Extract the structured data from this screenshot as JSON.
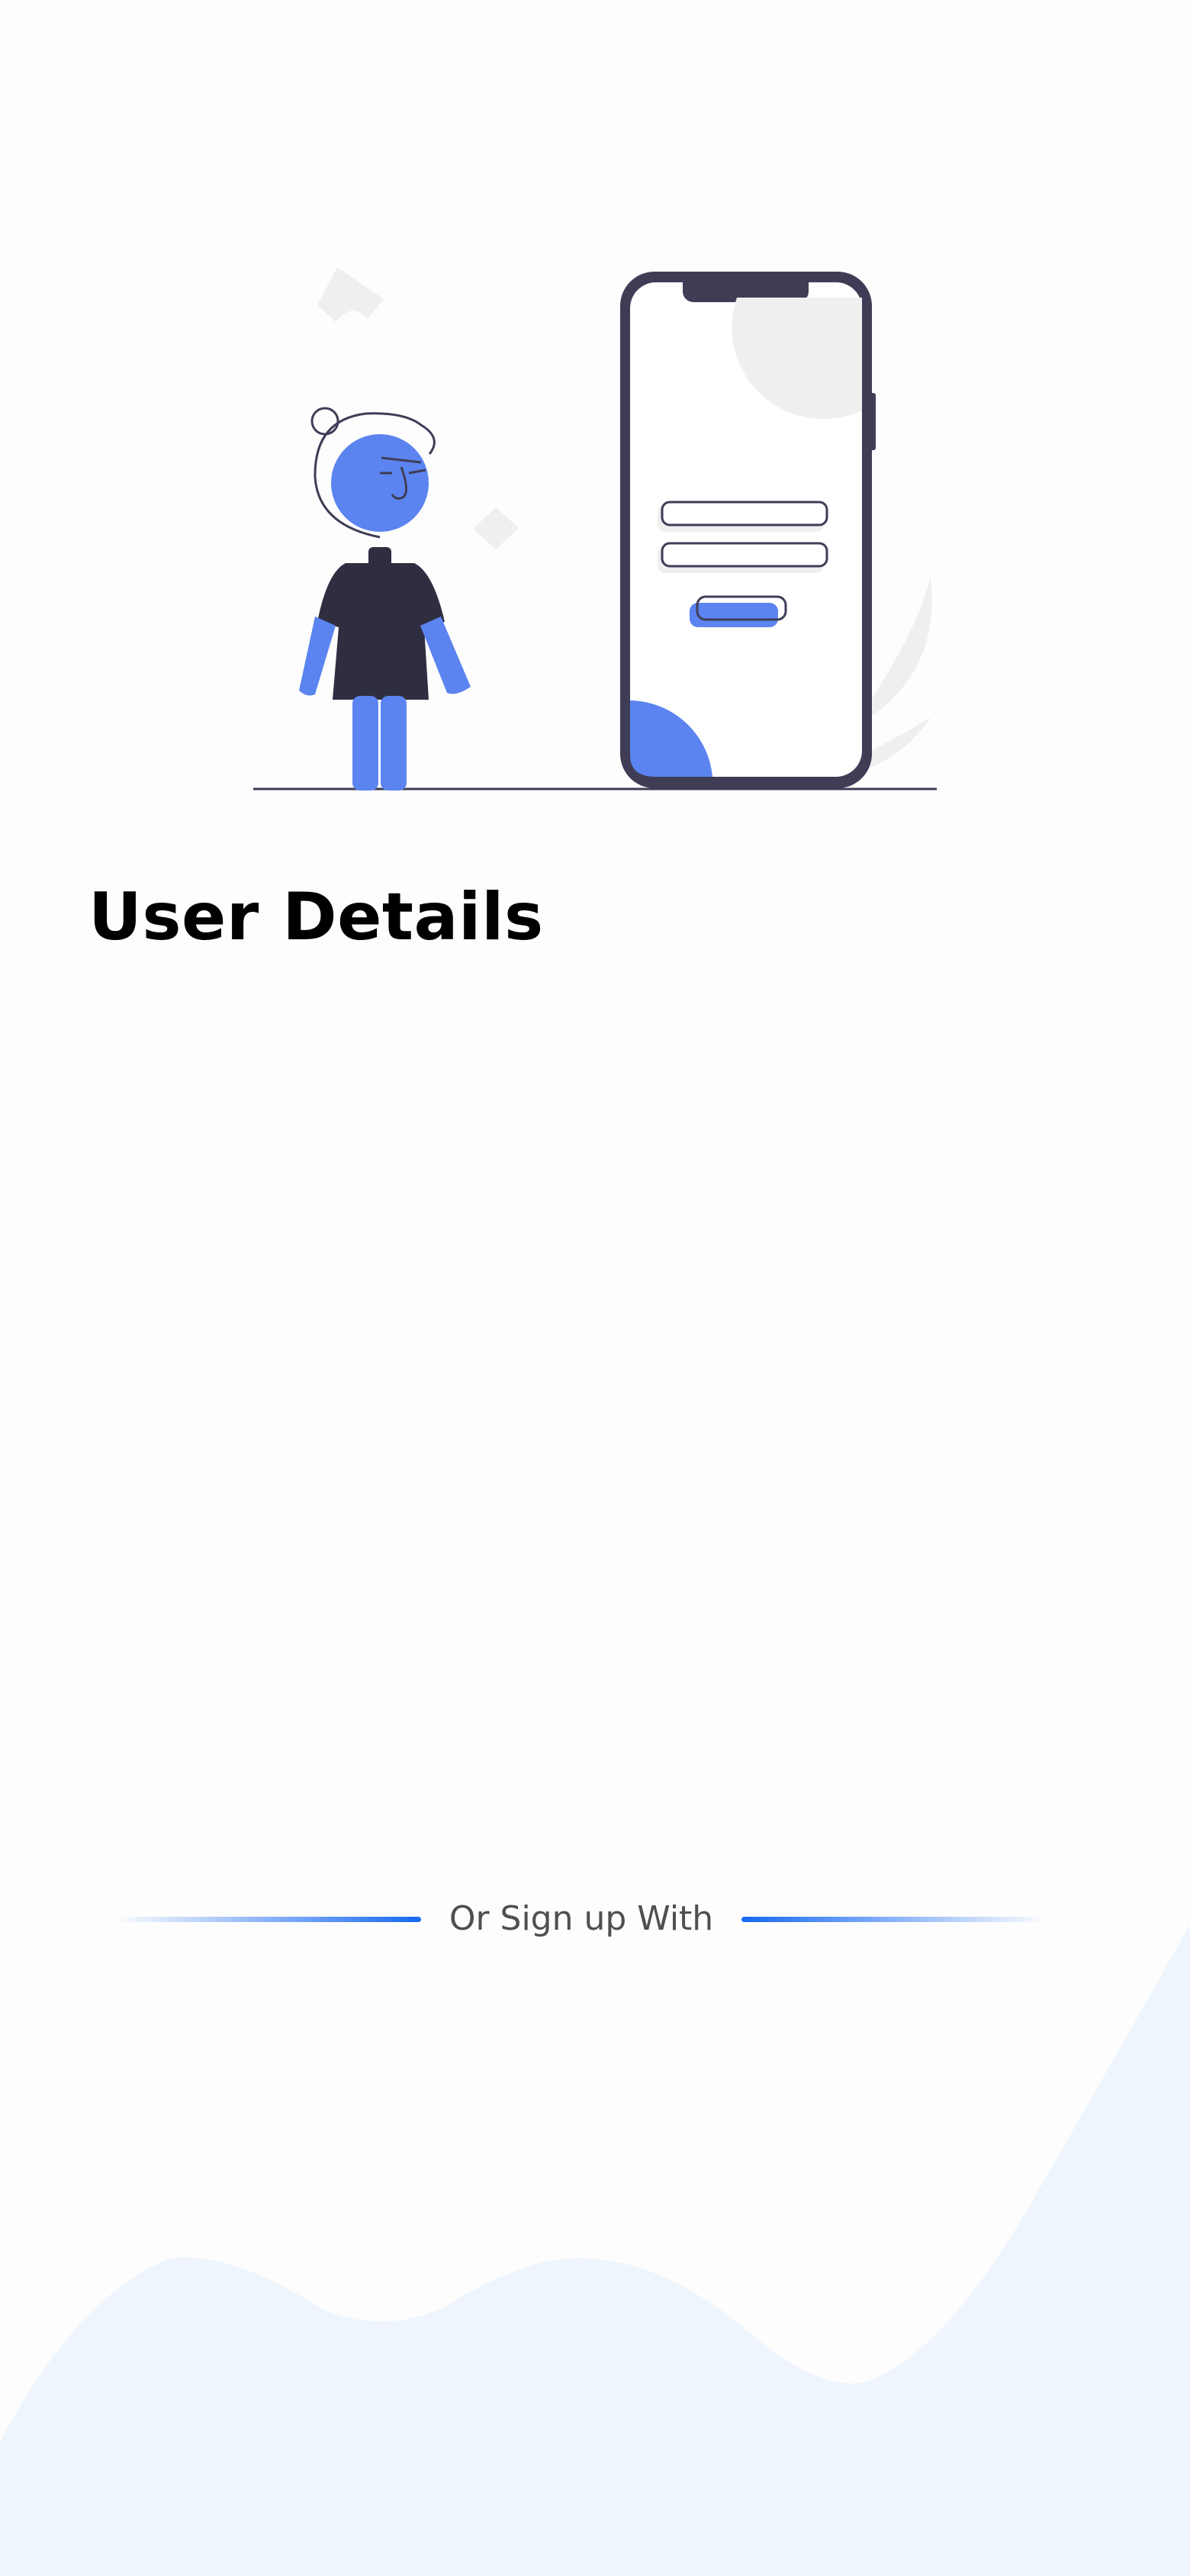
{
  "header": {
    "title": "User Details"
  },
  "divider": {
    "label": "Or Sign up With"
  },
  "colors": {
    "accent": "#1768f4",
    "illustration_blue": "#5b84f0",
    "illustration_dark": "#3f3d56",
    "wave_background": "#eef5fc"
  },
  "icons": {
    "hero": "person-with-phone-illustration"
  }
}
